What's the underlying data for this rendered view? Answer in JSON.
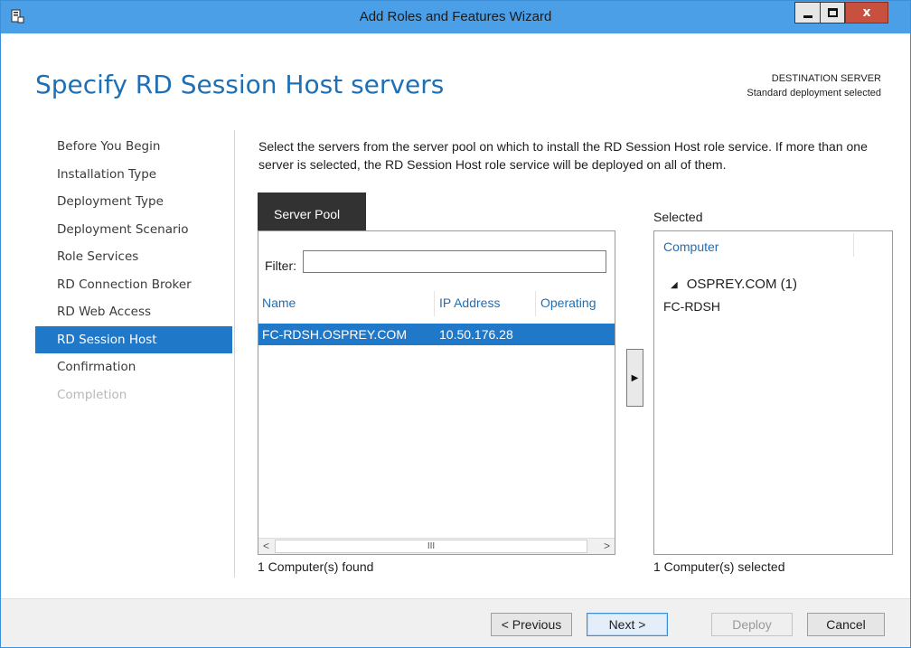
{
  "window": {
    "title": "Add Roles and Features Wizard",
    "accent": "#4a9fe6",
    "icons": {
      "app": "server-manager-icon",
      "min": "minimize-icon",
      "max": "maximize-icon",
      "close": "close-icon"
    }
  },
  "header": {
    "title": "Specify RD Session Host servers",
    "destination_label": "DESTINATION SERVER",
    "destination_value": "Standard deployment selected"
  },
  "nav": {
    "items": [
      {
        "label": "Before You Begin",
        "state": "normal"
      },
      {
        "label": "Installation Type",
        "state": "normal"
      },
      {
        "label": "Deployment Type",
        "state": "normal"
      },
      {
        "label": "Deployment Scenario",
        "state": "normal"
      },
      {
        "label": "Role Services",
        "state": "normal"
      },
      {
        "label": "RD Connection Broker",
        "state": "normal"
      },
      {
        "label": "RD Web Access",
        "state": "normal"
      },
      {
        "label": "RD Session Host",
        "state": "active"
      },
      {
        "label": "Confirmation",
        "state": "normal"
      },
      {
        "label": "Completion",
        "state": "disabled"
      }
    ]
  },
  "content": {
    "description": "Select the servers from the server pool on which to install the RD Session Host role service. If more than one server is selected, the RD Session Host role service will be deployed on all of them."
  },
  "pool": {
    "tab_label": "Server Pool",
    "filter_label": "Filter:",
    "filter_value": "",
    "columns": [
      "Name",
      "IP Address",
      "Operating"
    ],
    "rows": [
      {
        "name": "FC-RDSH.OSPREY.COM",
        "ip": "10.50.176.28",
        "os": "",
        "selected": true
      }
    ],
    "scroll": {
      "left": "<",
      "thumb": "III",
      "right": ">"
    },
    "found_text": "1 Computer(s) found"
  },
  "move_button": {
    "glyph": "▶"
  },
  "selected": {
    "label": "Selected",
    "column": "Computer",
    "group": "OSPREY.COM (1)",
    "group_glyph": "◢",
    "items": [
      "FC-RDSH"
    ],
    "count_text": "1 Computer(s) selected"
  },
  "footer": {
    "previous": "< Previous",
    "next": "Next >",
    "deploy": "Deploy",
    "cancel": "Cancel"
  }
}
